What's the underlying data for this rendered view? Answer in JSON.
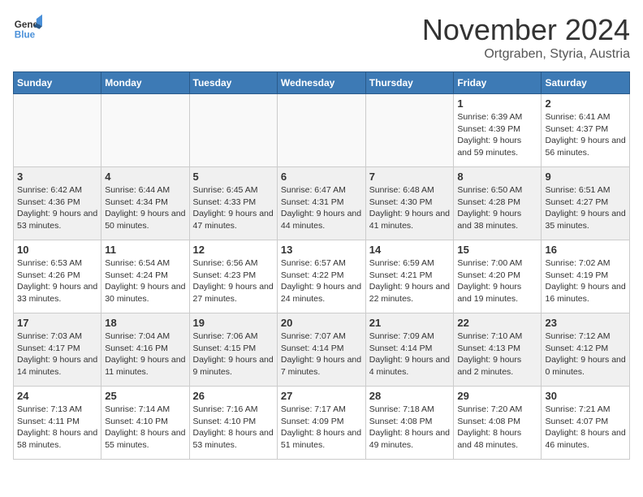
{
  "logo": {
    "line1": "General",
    "line2": "Blue"
  },
  "title": {
    "month": "November 2024",
    "location": "Ortgraben, Styria, Austria"
  },
  "weekdays": [
    "Sunday",
    "Monday",
    "Tuesday",
    "Wednesday",
    "Thursday",
    "Friday",
    "Saturday"
  ],
  "weeks": [
    [
      {
        "day": "",
        "info": ""
      },
      {
        "day": "",
        "info": ""
      },
      {
        "day": "",
        "info": ""
      },
      {
        "day": "",
        "info": ""
      },
      {
        "day": "",
        "info": ""
      },
      {
        "day": "1",
        "info": "Sunrise: 6:39 AM\nSunset: 4:39 PM\nDaylight: 9 hours and 59 minutes."
      },
      {
        "day": "2",
        "info": "Sunrise: 6:41 AM\nSunset: 4:37 PM\nDaylight: 9 hours and 56 minutes."
      }
    ],
    [
      {
        "day": "3",
        "info": "Sunrise: 6:42 AM\nSunset: 4:36 PM\nDaylight: 9 hours and 53 minutes."
      },
      {
        "day": "4",
        "info": "Sunrise: 6:44 AM\nSunset: 4:34 PM\nDaylight: 9 hours and 50 minutes."
      },
      {
        "day": "5",
        "info": "Sunrise: 6:45 AM\nSunset: 4:33 PM\nDaylight: 9 hours and 47 minutes."
      },
      {
        "day": "6",
        "info": "Sunrise: 6:47 AM\nSunset: 4:31 PM\nDaylight: 9 hours and 44 minutes."
      },
      {
        "day": "7",
        "info": "Sunrise: 6:48 AM\nSunset: 4:30 PM\nDaylight: 9 hours and 41 minutes."
      },
      {
        "day": "8",
        "info": "Sunrise: 6:50 AM\nSunset: 4:28 PM\nDaylight: 9 hours and 38 minutes."
      },
      {
        "day": "9",
        "info": "Sunrise: 6:51 AM\nSunset: 4:27 PM\nDaylight: 9 hours and 35 minutes."
      }
    ],
    [
      {
        "day": "10",
        "info": "Sunrise: 6:53 AM\nSunset: 4:26 PM\nDaylight: 9 hours and 33 minutes."
      },
      {
        "day": "11",
        "info": "Sunrise: 6:54 AM\nSunset: 4:24 PM\nDaylight: 9 hours and 30 minutes."
      },
      {
        "day": "12",
        "info": "Sunrise: 6:56 AM\nSunset: 4:23 PM\nDaylight: 9 hours and 27 minutes."
      },
      {
        "day": "13",
        "info": "Sunrise: 6:57 AM\nSunset: 4:22 PM\nDaylight: 9 hours and 24 minutes."
      },
      {
        "day": "14",
        "info": "Sunrise: 6:59 AM\nSunset: 4:21 PM\nDaylight: 9 hours and 22 minutes."
      },
      {
        "day": "15",
        "info": "Sunrise: 7:00 AM\nSunset: 4:20 PM\nDaylight: 9 hours and 19 minutes."
      },
      {
        "day": "16",
        "info": "Sunrise: 7:02 AM\nSunset: 4:19 PM\nDaylight: 9 hours and 16 minutes."
      }
    ],
    [
      {
        "day": "17",
        "info": "Sunrise: 7:03 AM\nSunset: 4:17 PM\nDaylight: 9 hours and 14 minutes."
      },
      {
        "day": "18",
        "info": "Sunrise: 7:04 AM\nSunset: 4:16 PM\nDaylight: 9 hours and 11 minutes."
      },
      {
        "day": "19",
        "info": "Sunrise: 7:06 AM\nSunset: 4:15 PM\nDaylight: 9 hours and 9 minutes."
      },
      {
        "day": "20",
        "info": "Sunrise: 7:07 AM\nSunset: 4:14 PM\nDaylight: 9 hours and 7 minutes."
      },
      {
        "day": "21",
        "info": "Sunrise: 7:09 AM\nSunset: 4:14 PM\nDaylight: 9 hours and 4 minutes."
      },
      {
        "day": "22",
        "info": "Sunrise: 7:10 AM\nSunset: 4:13 PM\nDaylight: 9 hours and 2 minutes."
      },
      {
        "day": "23",
        "info": "Sunrise: 7:12 AM\nSunset: 4:12 PM\nDaylight: 9 hours and 0 minutes."
      }
    ],
    [
      {
        "day": "24",
        "info": "Sunrise: 7:13 AM\nSunset: 4:11 PM\nDaylight: 8 hours and 58 minutes."
      },
      {
        "day": "25",
        "info": "Sunrise: 7:14 AM\nSunset: 4:10 PM\nDaylight: 8 hours and 55 minutes."
      },
      {
        "day": "26",
        "info": "Sunrise: 7:16 AM\nSunset: 4:10 PM\nDaylight: 8 hours and 53 minutes."
      },
      {
        "day": "27",
        "info": "Sunrise: 7:17 AM\nSunset: 4:09 PM\nDaylight: 8 hours and 51 minutes."
      },
      {
        "day": "28",
        "info": "Sunrise: 7:18 AM\nSunset: 4:08 PM\nDaylight: 8 hours and 49 minutes."
      },
      {
        "day": "29",
        "info": "Sunrise: 7:20 AM\nSunset: 4:08 PM\nDaylight: 8 hours and 48 minutes."
      },
      {
        "day": "30",
        "info": "Sunrise: 7:21 AM\nSunset: 4:07 PM\nDaylight: 8 hours and 46 minutes."
      }
    ]
  ]
}
